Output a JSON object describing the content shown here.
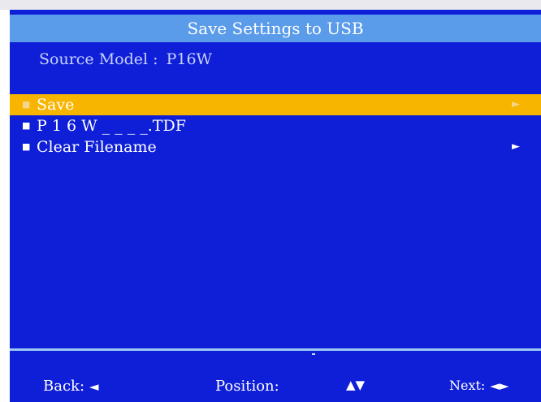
{
  "title": "Save Settings to USB",
  "source": {
    "label": "Source Model :",
    "value": "P16W"
  },
  "menu": {
    "items": [
      {
        "bullet": "■",
        "label": "Save",
        "arrow": "►"
      },
      {
        "bullet": "■",
        "label": "P 1 6 W _ _ _ _.TDF",
        "arrow": ""
      },
      {
        "bullet": "■",
        "label": "Clear Filename",
        "arrow": "►"
      }
    ]
  },
  "footer": {
    "back_label": "Back:",
    "back_symbol": "◄",
    "position_label": "Position:",
    "position_symbol": "▲▼",
    "next_label": "Next:",
    "next_symbol": "◄►"
  },
  "colors": {
    "background": "#0f1fd7",
    "title_bar": "#5a9bea",
    "selection": "#f7b500",
    "divider": "#9cc8f5"
  }
}
